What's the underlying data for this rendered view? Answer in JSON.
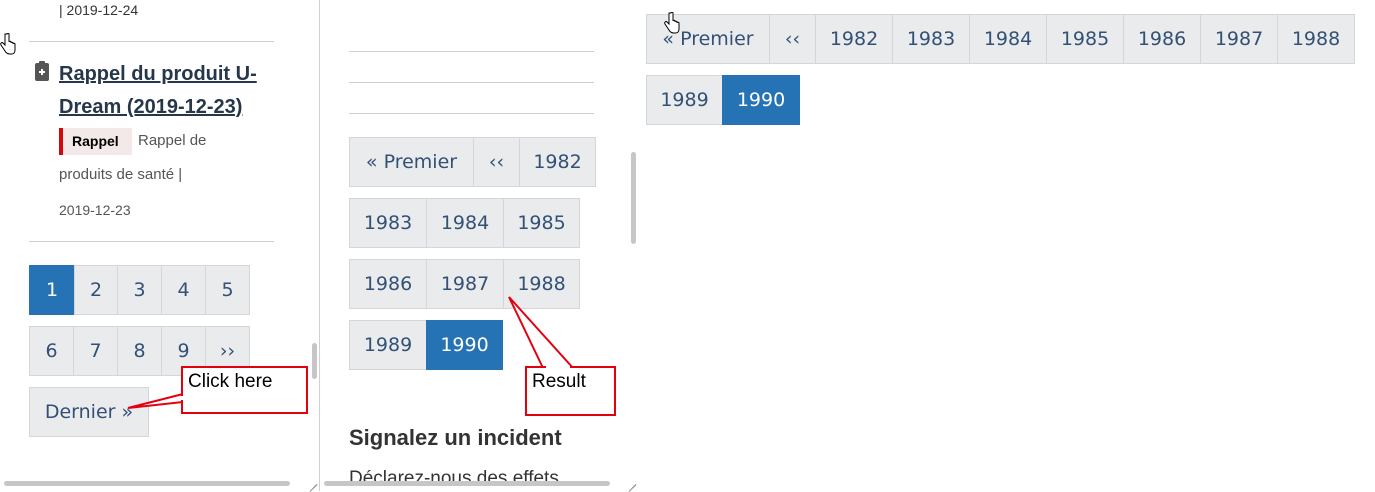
{
  "left_pane": {
    "prev_date": "| 2019-12-24",
    "recall": {
      "title": "Rappel du produit U-Dream (2019-12-23)",
      "badge": "Rappel",
      "category_line1": "Rappel de",
      "category_line2": "produits de santé |",
      "date": "2019-12-23"
    },
    "pager": {
      "pages": [
        "1",
        "2",
        "3",
        "4",
        "5",
        "6",
        "7",
        "8",
        "9",
        "››"
      ],
      "active": "1",
      "last_label": "Dernier »"
    }
  },
  "middle_pane": {
    "pager": {
      "first_label": "« Premier",
      "prev_label": "‹‹",
      "years": [
        "1982",
        "1983",
        "1984",
        "1985",
        "1986",
        "1987",
        "1988",
        "1989",
        "1990"
      ],
      "active": "1990"
    },
    "section_title": "Signalez un incident",
    "section_text": "Déclarez-nous des effets"
  },
  "right_pane": {
    "pager": {
      "first_label": "« Premier",
      "prev_label": "‹‹",
      "years": [
        "1982",
        "1983",
        "1984",
        "1985",
        "1986",
        "1987",
        "1988",
        "1989",
        "1990"
      ],
      "active": "1990"
    }
  },
  "annotations": {
    "click_here": "Click here",
    "result": "Result",
    "color": "#e3000f"
  },
  "colors": {
    "pager_bg": "#eaebed",
    "pager_text": "#335075",
    "active_bg": "#2572b4",
    "title_link": "#26374a",
    "badge_accent": "#d3080c"
  }
}
